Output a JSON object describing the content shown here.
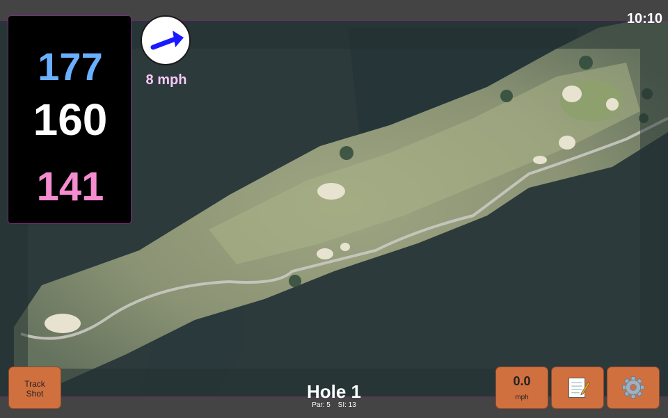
{
  "status_bar": {
    "time": "10:10"
  },
  "distances": {
    "back": "177",
    "middle": "160",
    "front": "141",
    "colors": {
      "back": "#6ab0ff",
      "middle": "#ffffff",
      "front": "#f48ccf"
    }
  },
  "wind": {
    "speed_label": "8 mph",
    "arrow_color": "#1a1aff",
    "icon": "wind-arrow-icon"
  },
  "hole": {
    "title": "Hole 1",
    "par_label": "Par: 5",
    "si_label": "SI: 13"
  },
  "buttons": {
    "track_shot": "Track\nShot",
    "speed_value": "0.0",
    "speed_unit": "mph",
    "notes_icon": "notepad-icon",
    "settings_icon": "gear-icon"
  },
  "colors": {
    "button_bg": "#d0703f",
    "bar_bg": "#444444",
    "bar_border": "#6b2a6b"
  }
}
